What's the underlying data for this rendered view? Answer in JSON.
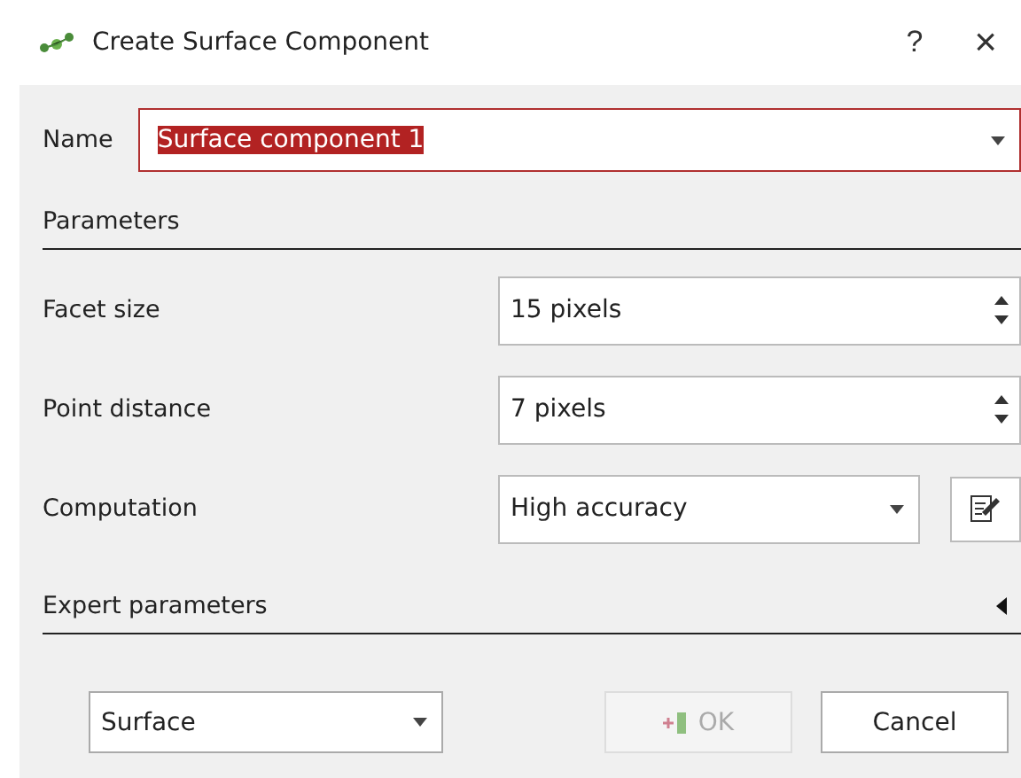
{
  "window": {
    "title": "Create Surface Component",
    "help": "?",
    "close": "×"
  },
  "name_field": {
    "label": "Name",
    "value": "Surface component 1",
    "selected": true
  },
  "parameters": {
    "title": "Parameters",
    "rows": [
      {
        "kind": "spin",
        "label": "Facet size",
        "value": "15 pixels"
      },
      {
        "kind": "spin",
        "label": "Point distance",
        "value": "7 pixels"
      },
      {
        "kind": "combo",
        "label": "Computation",
        "value": "High accuracy"
      }
    ]
  },
  "expert": {
    "title": "Expert parameters",
    "expanded": false
  },
  "footer": {
    "type_combo": "Surface",
    "ok": {
      "label": "OK",
      "disabled": true
    },
    "cancel": {
      "label": "Cancel",
      "disabled": false
    }
  }
}
